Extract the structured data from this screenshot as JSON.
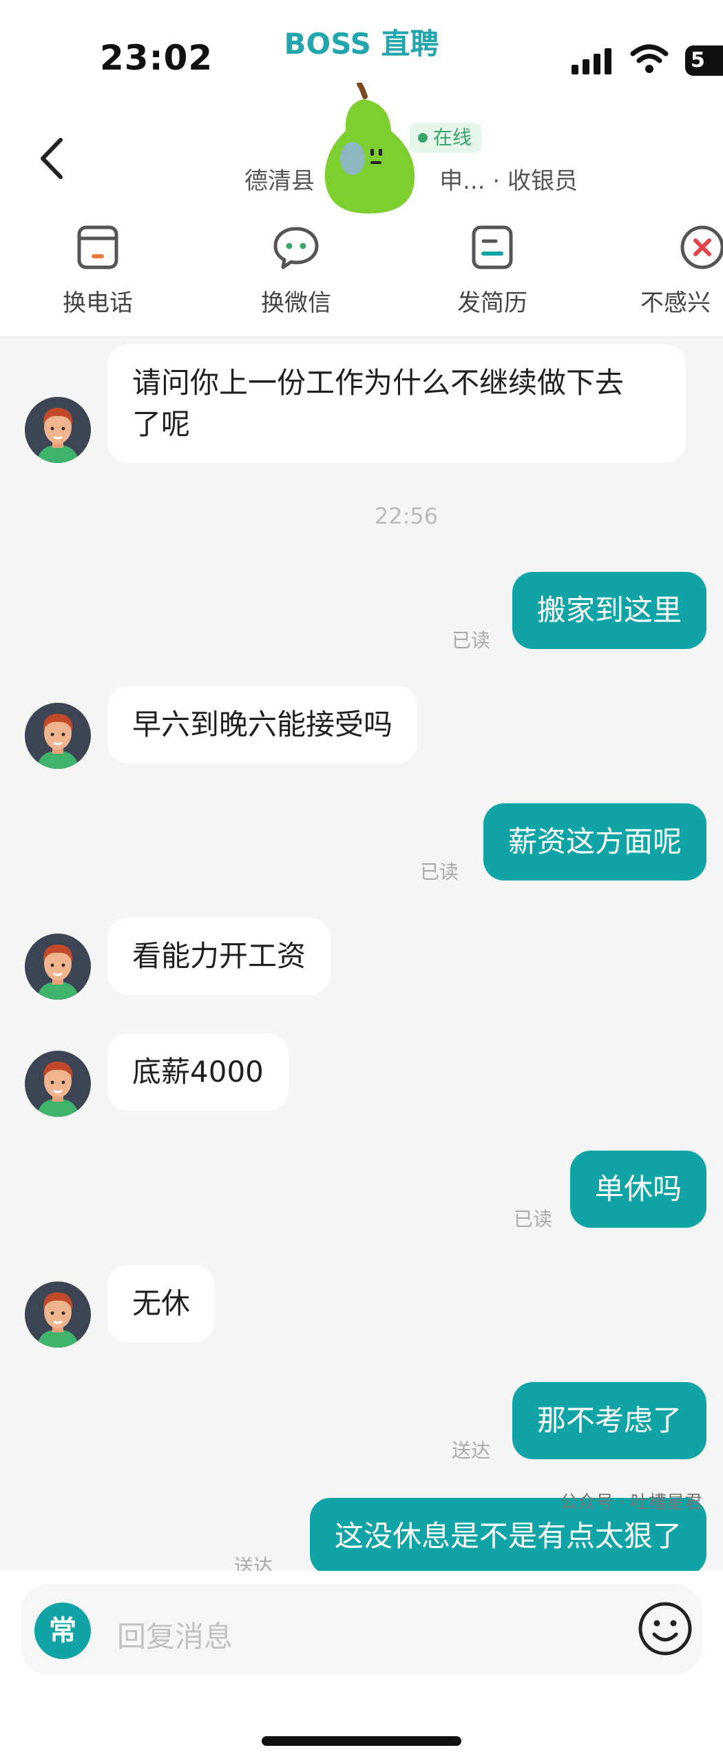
{
  "status_bar": {
    "time": "23:02",
    "brand": "BOSS 直聘",
    "battery": "5"
  },
  "header": {
    "online_label": "在线",
    "company_prefix": "德清县",
    "company_suffix": "申... · 收银员"
  },
  "actions": [
    {
      "label": "换电话",
      "icon": "phone-icon"
    },
    {
      "label": "换微信",
      "icon": "wechat-icon"
    },
    {
      "label": "发简历",
      "icon": "resume-icon"
    },
    {
      "label": "不感兴",
      "icon": "not-interested-icon"
    }
  ],
  "messages": [
    {
      "side": "in",
      "line1": "请问你上一份工作为什么不继续做下去",
      "line2": "了呢"
    },
    {
      "side": "time",
      "text": "22:56"
    },
    {
      "side": "out",
      "text": "搬家到这里",
      "status": "已读"
    },
    {
      "side": "in",
      "text": "早六到晚六能接受吗"
    },
    {
      "side": "out",
      "text": "薪资这方面呢",
      "status": "已读"
    },
    {
      "side": "in",
      "text": "看能力开工资"
    },
    {
      "side": "in",
      "text": "底薪4000"
    },
    {
      "side": "out",
      "text": "单休吗",
      "status": "已读"
    },
    {
      "side": "in",
      "text": "无休"
    },
    {
      "side": "out",
      "text": "那不考虑了",
      "status": "送达"
    },
    {
      "side": "out",
      "text": "这没休息是不是有点太狠了",
      "status": "送达"
    }
  ],
  "input": {
    "quick_label": "常",
    "placeholder": "回复消息"
  },
  "watermark": "公众号 · 吐槽星君",
  "colors": {
    "accent": "#10a4a6",
    "brand": "#23a5ae",
    "online": "#3aa56a"
  }
}
